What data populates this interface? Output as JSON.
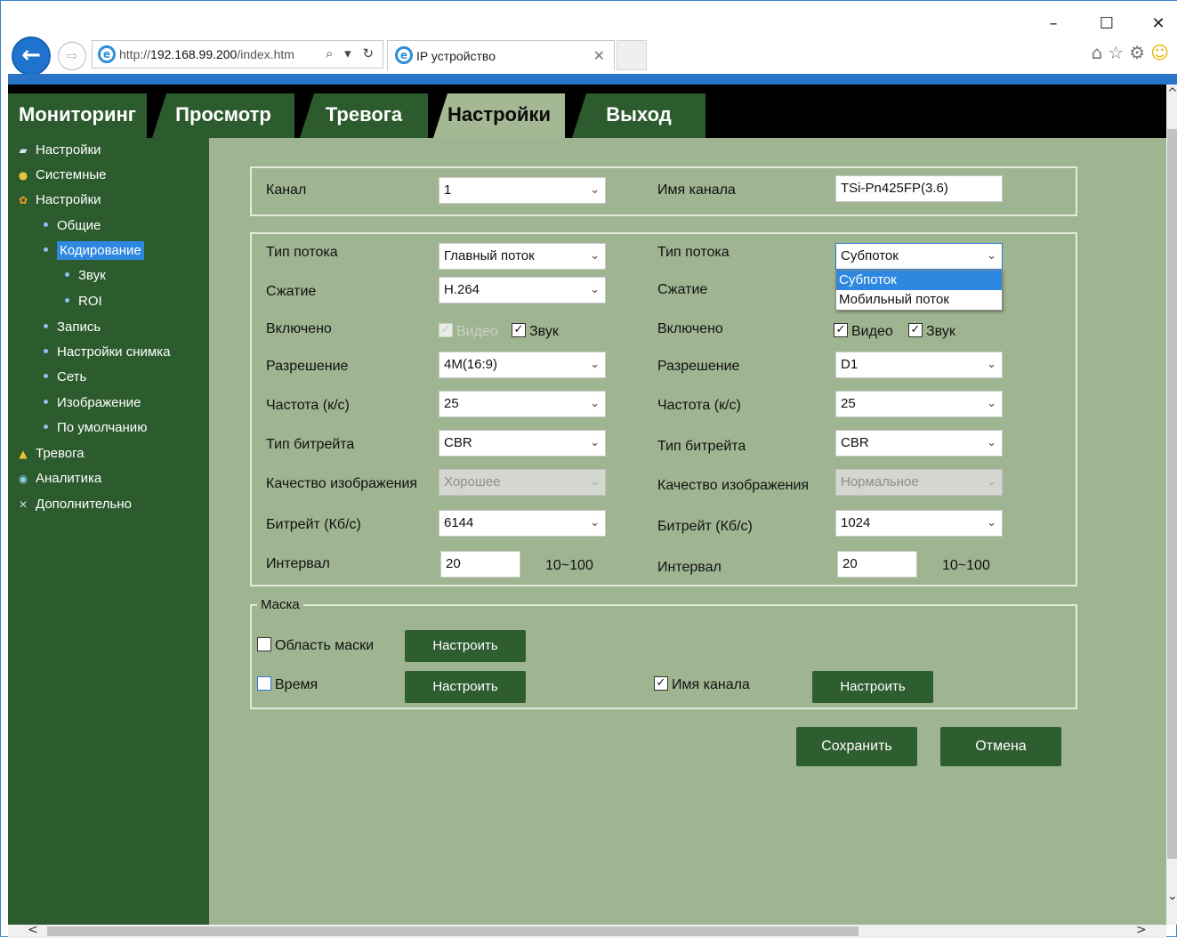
{
  "browser": {
    "url_prefix": "http://",
    "url_host": "192.168.99.200",
    "url_path": "/index.htm",
    "tab_title": "IP устройство",
    "address_actions": "⌕ ▾ ↻",
    "window_controls": {
      "minimize": "–",
      "maximize": "☐",
      "close": "✕"
    },
    "toolbar_icons": [
      "home-icon",
      "star-icon",
      "gear-icon",
      "smiley-icon"
    ]
  },
  "nav": {
    "tabs": [
      {
        "label": "Мониторинг"
      },
      {
        "label": "Просмотр"
      },
      {
        "label": "Тревога"
      },
      {
        "label": "Настройки"
      },
      {
        "label": "Выход"
      }
    ],
    "active": "Настройки"
  },
  "sidebar": {
    "items": [
      {
        "label": "Настройки",
        "icon": "settings-book-icon"
      },
      {
        "label": "Системные",
        "icon": "info-icon"
      },
      {
        "label": "Настройки",
        "icon": "gear-icon"
      },
      {
        "label": "Общие"
      },
      {
        "label": "Кодирование"
      },
      {
        "label": "Звук"
      },
      {
        "label": "ROI"
      },
      {
        "label": "Запись"
      },
      {
        "label": "Настройки снимка"
      },
      {
        "label": "Сеть"
      },
      {
        "label": "Изображение"
      },
      {
        "label": "По умолчанию"
      },
      {
        "label": "Тревога",
        "icon": "alarm-icon"
      },
      {
        "label": "Аналитика",
        "icon": "analytics-icon"
      },
      {
        "label": "Дополнительно",
        "icon": "tools-icon"
      }
    ],
    "selected": "Кодирование"
  },
  "channel": {
    "label": "Канал",
    "value": "1",
    "name_label": "Имя канала",
    "name_value": "TSi-Pn425FP(3.6)"
  },
  "main_stream": {
    "stream_type_label": "Тип потока",
    "stream_type": "Главный поток",
    "compression_label": "Сжатие",
    "compression": "H.264",
    "enabled_label": "Включено",
    "video_label": "Видео",
    "video_checked": true,
    "audio_label": "Звук",
    "audio_checked": true,
    "resolution_label": "Разрешение",
    "resolution": "4M(16:9)",
    "fps_label": "Частота (к/с)",
    "fps": "25",
    "bitrate_type_label": "Тип битрейта",
    "bitrate_type": "CBR",
    "quality_label": "Качество изображения",
    "quality": "Хорошее",
    "bitrate_label": "Битрейт (Кб/с)",
    "bitrate": "6144",
    "interval_label": "Интервал",
    "interval": "20",
    "interval_range": "10~100"
  },
  "sub_stream": {
    "stream_type_label": "Тип потока",
    "stream_type": "Субпоток",
    "stream_type_options": [
      "Субпоток",
      "Мобильный поток"
    ],
    "compression_label": "Сжатие",
    "enabled_label": "Включено",
    "video_label": "Видео",
    "video_checked": true,
    "audio_label": "Звук",
    "audio_checked": true,
    "resolution_label": "Разрешение",
    "resolution": "D1",
    "fps_label": "Частота (к/с)",
    "fps": "25",
    "bitrate_type_label": "Тип битрейта",
    "bitrate_type": "CBR",
    "quality_label": "Качество изображения",
    "quality": "Нормальное",
    "bitrate_label": "Битрейт (Кб/с)",
    "bitrate": "1024",
    "interval_label": "Интервал",
    "interval": "20",
    "interval_range": "10~100"
  },
  "mask": {
    "legend": "Маска",
    "mask_area_label": "Область маски",
    "mask_area_checked": false,
    "time_label": "Время",
    "time_checked": false,
    "channel_name_label": "Имя канала",
    "channel_name_checked": true,
    "configure_label": "Настроить"
  },
  "actions": {
    "save_label": "Сохранить",
    "cancel_label": "Отмена"
  },
  "colors": {
    "nav_green": "#2c5b2e",
    "content_bg": "#9fb591",
    "active_tab": "#a3b893",
    "selection_blue": "#2f88e0",
    "browser_blue": "#2a74c8"
  }
}
